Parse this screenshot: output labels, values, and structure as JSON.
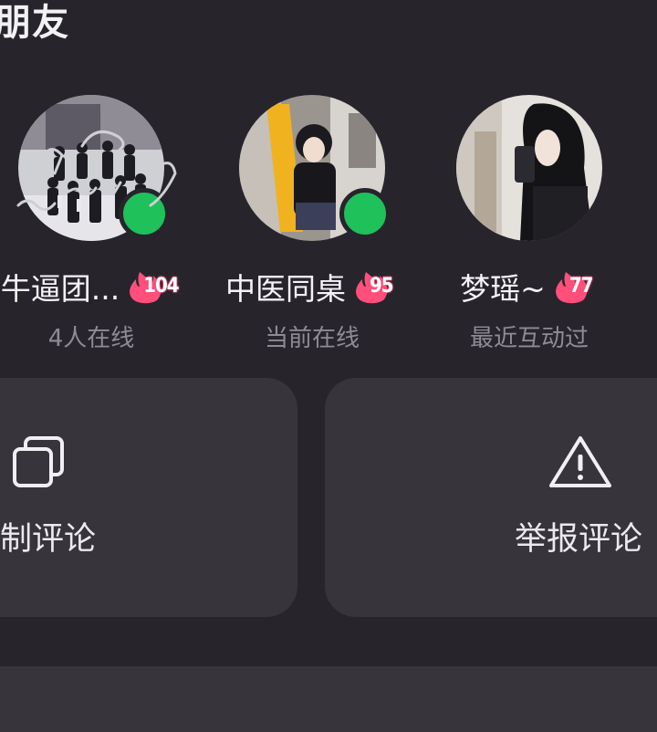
{
  "section": {
    "title": "朋友"
  },
  "friends": [
    {
      "name": "牛逼团...",
      "streak": "104",
      "status": "4人在线",
      "online": true
    },
    {
      "name": "中医同桌",
      "streak": "95",
      "status": "当前在线",
      "online": true
    },
    {
      "name": "梦瑶~",
      "streak": "77",
      "status": "最近互动过",
      "online": false
    }
  ],
  "actions": [
    {
      "label": "制评论",
      "icon": "copy-icon"
    },
    {
      "label": "举报评论",
      "icon": "warning-icon"
    }
  ],
  "colors": {
    "background": "#27242c",
    "card": "#37343c",
    "online": "#1ec15a",
    "streak": "#ff4f7a",
    "status_text": "#8e8b95"
  }
}
